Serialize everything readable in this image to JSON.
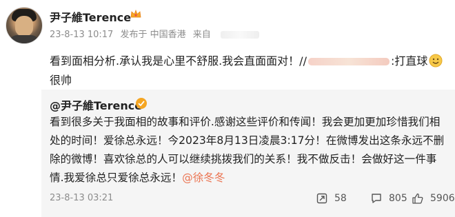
{
  "post": {
    "author": "尹子維Terence",
    "time": "23-8-13 10:17",
    "published_in": "发布于 中国香港",
    "source_label": "来自",
    "text_a": "看到面相分析.承认我是心里不舒服.我会直面面对！//",
    "text_b": ":打直球",
    "text_c": "很帅"
  },
  "repost": {
    "author": "@尹子維Terence",
    "text": "看到很多关于我面相的故事和评价.感谢这些评价和传闻！我会更加更加珍惜我们相处的时间！爱徐总永远！今2023年8月13日凌晨3:17分！在微博发出这条永远不删除的微博！喜欢徐总的人可以继续挑拨我们的关系！我不做反击！会做好这一件事情.我爱徐总只爱徐总永远！",
    "mention": "@徐冬冬",
    "time": "23-8-13 03:21",
    "reposts": "58",
    "comments": "805",
    "likes": "5906"
  },
  "colors": {
    "mention": "#eb7350",
    "verified": "#f5a623",
    "meta": "#8c8c8c"
  },
  "icons": [
    "crown-icon",
    "smile-icon",
    "verified-icon",
    "repost-icon",
    "comment-icon",
    "like-icon"
  ]
}
